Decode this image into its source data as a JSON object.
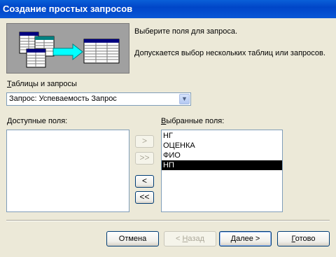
{
  "window": {
    "title": "Создание простых запросов"
  },
  "intro": {
    "line1": "Выберите поля для запроса.",
    "line2": "Допускается выбор нескольких таблиц или запросов."
  },
  "tables": {
    "label_hotkey": "Т",
    "label_rest": "аблицы и запросы",
    "selected": "Запрос: Успеваемость Запрос"
  },
  "available": {
    "label_hotkey": "Д",
    "label_rest": "оступные поля:",
    "items": []
  },
  "selected_fields": {
    "label_hotkey": "В",
    "label_rest": "ыбранные поля:",
    "items": [
      "НГ",
      "ОЦЕНКА",
      "ФИО",
      "НП"
    ],
    "selected_index": 3
  },
  "move": {
    "add_one": ">",
    "add_all": ">>",
    "remove_one": "<",
    "remove_all": "<<"
  },
  "footer": {
    "cancel": "Отмена",
    "back_prefix": "< ",
    "back_hotkey": "Н",
    "back_rest": "азад",
    "next_hotkey": "Д",
    "next_rest": "алее >",
    "finish_hotkey": "Г",
    "finish_rest": "отово"
  },
  "colors": {
    "titlebar": "#0046C8",
    "dialog": "#ECE9D8",
    "selection": "#000000"
  },
  "icons": {
    "wizard_graphic": "query-wizard-graphic",
    "dropdown": "chevron-down-icon"
  }
}
